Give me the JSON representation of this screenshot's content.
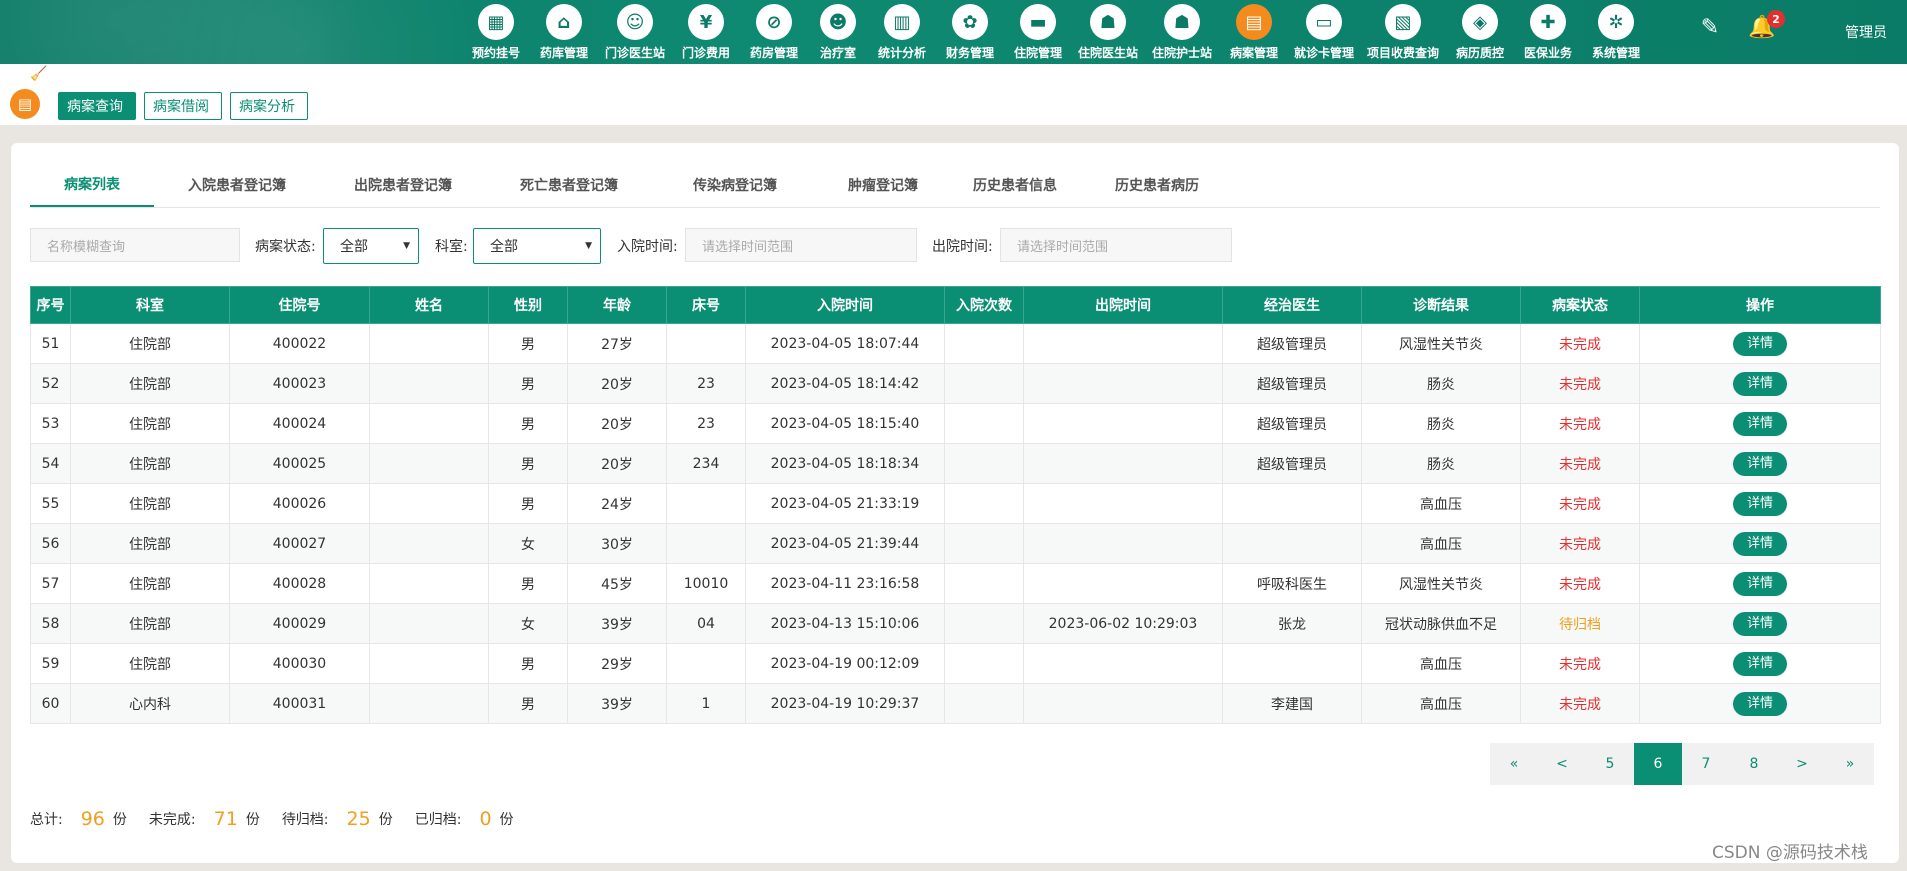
{
  "nav": [
    {
      "label": "预约挂号",
      "icon": "calendar-icon",
      "glyph": "▦"
    },
    {
      "label": "药库管理",
      "icon": "warehouse-icon",
      "glyph": "⌂"
    },
    {
      "label": "门诊医生站",
      "icon": "doctor-icon",
      "glyph": "☺"
    },
    {
      "label": "门诊费用",
      "icon": "yen-icon",
      "glyph": "¥"
    },
    {
      "label": "药房管理",
      "icon": "pill-icon",
      "glyph": "⊘"
    },
    {
      "label": "治疗室",
      "icon": "nurse-icon",
      "glyph": "☻"
    },
    {
      "label": "统计分析",
      "icon": "chart-icon",
      "glyph": "▥"
    },
    {
      "label": "财务管理",
      "icon": "gear-coin-icon",
      "glyph": "✿"
    },
    {
      "label": "住院管理",
      "icon": "bed-icon",
      "glyph": "▬"
    },
    {
      "label": "住院医生站",
      "icon": "doctor-desk-icon",
      "glyph": "☗"
    },
    {
      "label": "住院护士站",
      "icon": "nurse-station-icon",
      "glyph": "☗"
    },
    {
      "label": "病案管理",
      "icon": "medical-record-icon",
      "glyph": "▤",
      "active": true
    },
    {
      "label": "就诊卡管理",
      "icon": "card-icon",
      "glyph": "▭"
    },
    {
      "label": "项目收费查询",
      "icon": "fee-search-icon",
      "glyph": "▧"
    },
    {
      "label": "病历质控",
      "icon": "quality-control-icon",
      "glyph": "◈"
    },
    {
      "label": "医保业务",
      "icon": "insurance-icon",
      "glyph": "✚"
    },
    {
      "label": "系统管理",
      "icon": "settings-icon",
      "glyph": "✲"
    }
  ],
  "header": {
    "badge_count": "2",
    "user": "管理员"
  },
  "subnav": {
    "query": "病案查询",
    "borrow": "病案借阅",
    "analysis": "病案分析"
  },
  "tabs": [
    "病案列表",
    "入院患者登记簿",
    "出院患者登记簿",
    "死亡患者登记簿",
    "传染病登记簿",
    "肿瘤登记簿",
    "历史患者信息",
    "历史患者病历"
  ],
  "filters": {
    "name_placeholder": "名称模糊查询",
    "status_label": "病案状态:",
    "status_value": "全部",
    "dept_label": "科室:",
    "dept_value": "全部",
    "admit_label": "入院时间:",
    "admit_placeholder": "请选择时间范围",
    "discharge_label": "出院时间:",
    "discharge_placeholder": "请选择时间范围"
  },
  "table": {
    "headers": [
      "序号",
      "科室",
      "住院号",
      "姓名",
      "性别",
      "年龄",
      "床号",
      "入院时间",
      "入院次数",
      "出院时间",
      "经治医生",
      "诊断结果",
      "病案状态",
      "操作"
    ],
    "action_label": "详情",
    "rows": [
      {
        "no": "51",
        "dept": "住院部",
        "inpatient_no": "400022",
        "name": "",
        "sex": "男",
        "age": "27岁",
        "bed": "",
        "admit_time": "2023-04-05 18:07:44",
        "admit_count": "",
        "discharge_time": "",
        "doctor": "超级管理员",
        "diagnosis": "风湿性关节炎",
        "status": "未完成",
        "status_color": "#e23030"
      },
      {
        "no": "52",
        "dept": "住院部",
        "inpatient_no": "400023",
        "name": "",
        "sex": "男",
        "age": "20岁",
        "bed": "23",
        "admit_time": "2023-04-05 18:14:42",
        "admit_count": "",
        "discharge_time": "",
        "doctor": "超级管理员",
        "diagnosis": "肠炎",
        "status": "未完成",
        "status_color": "#e23030"
      },
      {
        "no": "53",
        "dept": "住院部",
        "inpatient_no": "400024",
        "name": "",
        "sex": "男",
        "age": "20岁",
        "bed": "23",
        "admit_time": "2023-04-05 18:15:40",
        "admit_count": "",
        "discharge_time": "",
        "doctor": "超级管理员",
        "diagnosis": "肠炎",
        "status": "未完成",
        "status_color": "#e23030"
      },
      {
        "no": "54",
        "dept": "住院部",
        "inpatient_no": "400025",
        "name": "",
        "sex": "男",
        "age": "20岁",
        "bed": "234",
        "admit_time": "2023-04-05 18:18:34",
        "admit_count": "",
        "discharge_time": "",
        "doctor": "超级管理员",
        "diagnosis": "肠炎",
        "status": "未完成",
        "status_color": "#e23030"
      },
      {
        "no": "55",
        "dept": "住院部",
        "inpatient_no": "400026",
        "name": "",
        "sex": "男",
        "age": "24岁",
        "bed": "",
        "admit_time": "2023-04-05 21:33:19",
        "admit_count": "",
        "discharge_time": "",
        "doctor": "",
        "diagnosis": "高血压",
        "status": "未完成",
        "status_color": "#e23030"
      },
      {
        "no": "56",
        "dept": "住院部",
        "inpatient_no": "400027",
        "name": "",
        "sex": "女",
        "age": "30岁",
        "bed": "",
        "admit_time": "2023-04-05 21:39:44",
        "admit_count": "",
        "discharge_time": "",
        "doctor": "",
        "diagnosis": "高血压",
        "status": "未完成",
        "status_color": "#e23030"
      },
      {
        "no": "57",
        "dept": "住院部",
        "inpatient_no": "400028",
        "name": "",
        "sex": "男",
        "age": "45岁",
        "bed": "10010",
        "admit_time": "2023-04-11 23:16:58",
        "admit_count": "",
        "discharge_time": "",
        "doctor": "呼吸科医生",
        "diagnosis": "风湿性关节炎",
        "status": "未完成",
        "status_color": "#e23030"
      },
      {
        "no": "58",
        "dept": "住院部",
        "inpatient_no": "400029",
        "name": "",
        "sex": "女",
        "age": "39岁",
        "bed": "04",
        "admit_time": "2023-04-13 15:10:06",
        "admit_count": "",
        "discharge_time": "2023-06-02 10:29:03",
        "doctor": "张龙",
        "diagnosis": "冠状动脉供血不足",
        "status": "待归档",
        "status_color": "#f0a020"
      },
      {
        "no": "59",
        "dept": "住院部",
        "inpatient_no": "400030",
        "name": "",
        "sex": "男",
        "age": "29岁",
        "bed": "",
        "admit_time": "2023-04-19 00:12:09",
        "admit_count": "",
        "discharge_time": "",
        "doctor": "",
        "diagnosis": "高血压",
        "status": "未完成",
        "status_color": "#e23030"
      },
      {
        "no": "60",
        "dept": "心内科",
        "inpatient_no": "400031",
        "name": "",
        "sex": "男",
        "age": "39岁",
        "bed": "1",
        "admit_time": "2023-04-19 10:29:37",
        "admit_count": "",
        "discharge_time": "",
        "doctor": "李建国",
        "diagnosis": "高血压",
        "status": "未完成",
        "status_color": "#e23030"
      }
    ]
  },
  "pagination": {
    "first": "«",
    "prev": "<",
    "pages": [
      "5",
      "6",
      "7",
      "8"
    ],
    "current": "6",
    "next": ">",
    "last": "»"
  },
  "summary": {
    "total_label": "总计:",
    "total": "96",
    "unit": "份",
    "incomplete_label": "未完成:",
    "incomplete": "71",
    "pending_label": "待归档:",
    "pending": "25",
    "archived_label": "已归档:",
    "archived": "0"
  },
  "watermark": "CSDN @源码技术栈",
  "colors": {
    "brand": "#0b8f74",
    "header": "#0b7a66",
    "accent": "#f38b1f",
    "danger": "#e23030",
    "warning": "#f0a020"
  }
}
